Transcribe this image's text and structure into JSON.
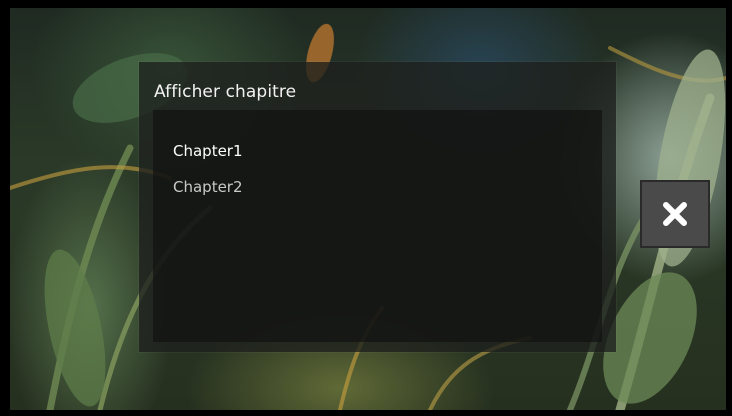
{
  "dialog": {
    "title": "Afficher chapitre",
    "chapters": [
      {
        "label": "Chapter1",
        "selected": true
      },
      {
        "label": "Chapter2",
        "selected": false
      }
    ]
  },
  "close_button": {
    "icon": "close-icon"
  },
  "colors": {
    "dialog_bg": "#1e201e",
    "list_bg": "#121212",
    "text_primary": "#ffffff",
    "text_secondary": "#c9c9c9",
    "close_button_bg": "#4a4a4a"
  }
}
